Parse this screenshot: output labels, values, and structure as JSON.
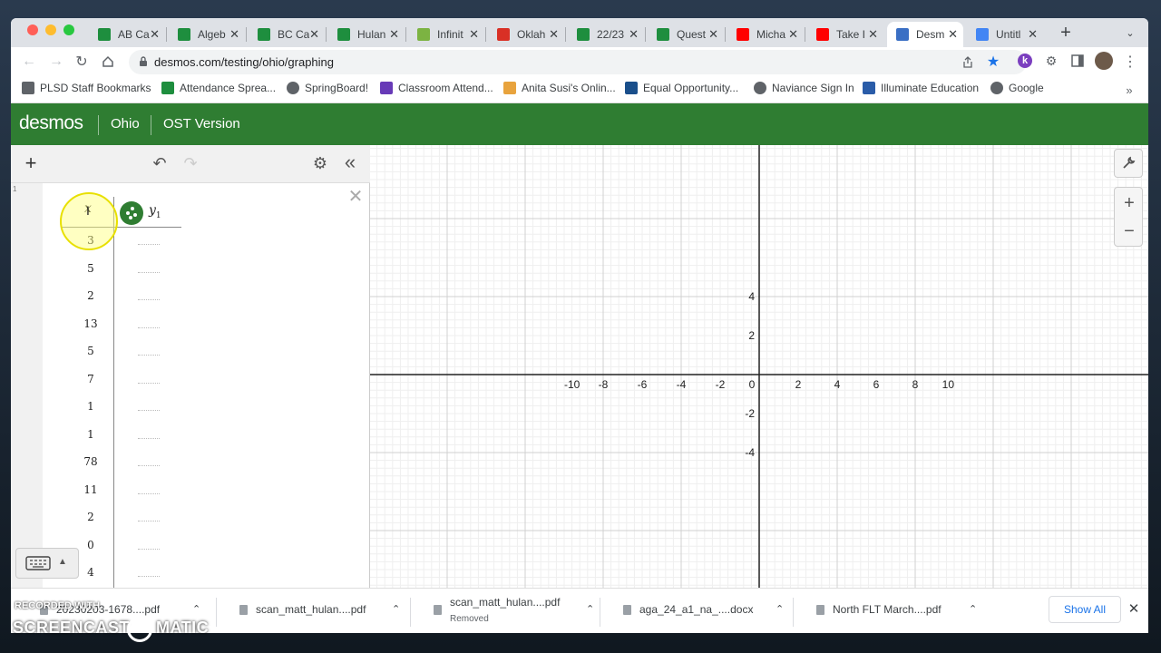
{
  "browser": {
    "tabs": [
      {
        "title": "AB Ca",
        "icon": "google-sheets-icon",
        "color": "#1e8e3e"
      },
      {
        "title": "Algeb",
        "icon": "google-sheets-icon",
        "color": "#1e8e3e"
      },
      {
        "title": "BC Ca",
        "icon": "google-sheets-icon",
        "color": "#1e8e3e"
      },
      {
        "title": "Hulan",
        "icon": "google-sheets-icon",
        "color": "#1e8e3e"
      },
      {
        "title": "Infinit",
        "icon": "infinite-campus-icon",
        "color": "#7cb342"
      },
      {
        "title": "Oklah",
        "icon": "gmail-icon",
        "color": "#d93025"
      },
      {
        "title": "22/23",
        "icon": "google-sheets-icon",
        "color": "#1e8e3e"
      },
      {
        "title": "Quest",
        "icon": "google-sheets-icon",
        "color": "#1e8e3e"
      },
      {
        "title": "Micha",
        "icon": "youtube-icon",
        "color": "#ff0000"
      },
      {
        "title": "Take I",
        "icon": "youtube-icon",
        "color": "#ff0000"
      },
      {
        "title": "Desm",
        "icon": "desmos-icon",
        "color": "#3a6fc4"
      },
      {
        "title": "Untitl",
        "icon": "google-docs-icon",
        "color": "#4285f4"
      }
    ],
    "active_tab": 10,
    "url": "desmos.com/testing/ohio/graphing",
    "profile_badge": "k",
    "bookmarks": [
      {
        "label": "PLSD Staff Bookmarks",
        "icon": "folder-icon"
      },
      {
        "label": "Attendance Sprea...",
        "icon": "google-sheets-icon"
      },
      {
        "label": "SpringBoard!",
        "icon": "globe-icon"
      },
      {
        "label": "Classroom Attend...",
        "icon": "google-forms-icon"
      },
      {
        "label": "Anita Susi's Onlin...",
        "icon": "sl-icon"
      },
      {
        "label": "Equal Opportunity...",
        "icon": "book-icon"
      },
      {
        "label": "Naviance Sign In",
        "icon": "globe-icon"
      },
      {
        "label": "Illuminate Education",
        "icon": "illuminate-icon"
      },
      {
        "label": "Google",
        "icon": "globe-icon"
      }
    ]
  },
  "desmos": {
    "logo": "desmos",
    "state": "Ohio",
    "version": "OST Version",
    "accent": "#2f7d32",
    "line_number": "1",
    "table": {
      "x_header": "x",
      "y_header": "y",
      "y_subscript": "1",
      "x_values": [
        "3",
        "5",
        "2",
        "13",
        "5",
        "7",
        "1",
        "1",
        "78",
        "11",
        "2",
        "0",
        "4"
      ]
    },
    "graph": {
      "x_ticks": [
        "-10",
        "-8",
        "-6",
        "-4",
        "-2",
        "0",
        "2",
        "4",
        "6",
        "8",
        "10"
      ],
      "y_ticks": [
        "4",
        "2",
        "-2",
        "-4"
      ]
    }
  },
  "downloads": {
    "items": [
      {
        "name": "20230203-1678....pdf",
        "sub": ""
      },
      {
        "name": "scan_matt_hulan....pdf",
        "sub": ""
      },
      {
        "name": "scan_matt_hulan....pdf",
        "sub": "Removed"
      },
      {
        "name": "aga_24_a1_na_....docx",
        "sub": ""
      },
      {
        "name": "North FLT March....pdf",
        "sub": ""
      }
    ],
    "show_all": "Show All"
  },
  "watermark": {
    "line1": "RECORDED WITH",
    "line2": "SCREENCAST",
    "line3": "MATIC"
  }
}
